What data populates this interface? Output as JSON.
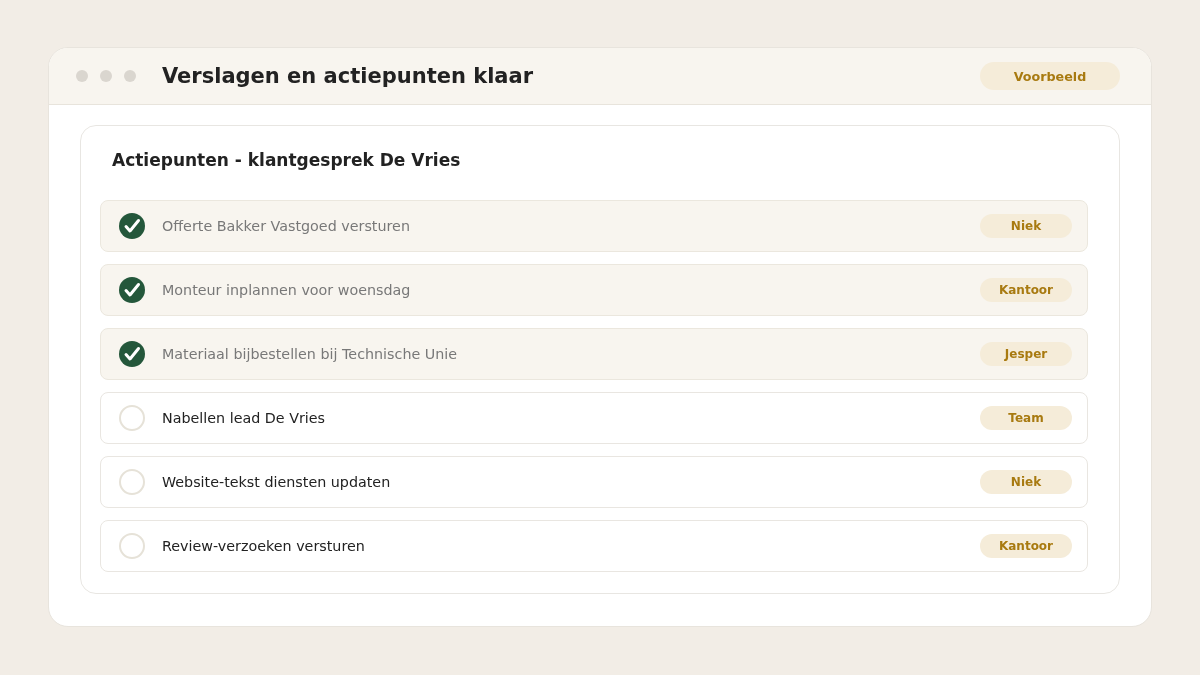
{
  "window": {
    "title": "Verslagen en actiepunten klaar",
    "badge": "Voorbeeld"
  },
  "card": {
    "title": "Actiepunten - klantgesprek De Vries",
    "items": [
      {
        "text": "Offerte Bakker Vastgoed versturen",
        "checked": true,
        "assignee": "Niek"
      },
      {
        "text": "Monteur inplannen voor woensdag",
        "checked": true,
        "assignee": "Kantoor"
      },
      {
        "text": "Materiaal bijbestellen bij Technische Unie",
        "checked": true,
        "assignee": "Jesper"
      },
      {
        "text": "Nabellen lead De Vries",
        "checked": false,
        "assignee": "Team"
      },
      {
        "text": "Website-tekst diensten updaten",
        "checked": false,
        "assignee": "Niek"
      },
      {
        "text": "Review-verzoeken versturen",
        "checked": false,
        "assignee": "Kantoor"
      }
    ]
  }
}
